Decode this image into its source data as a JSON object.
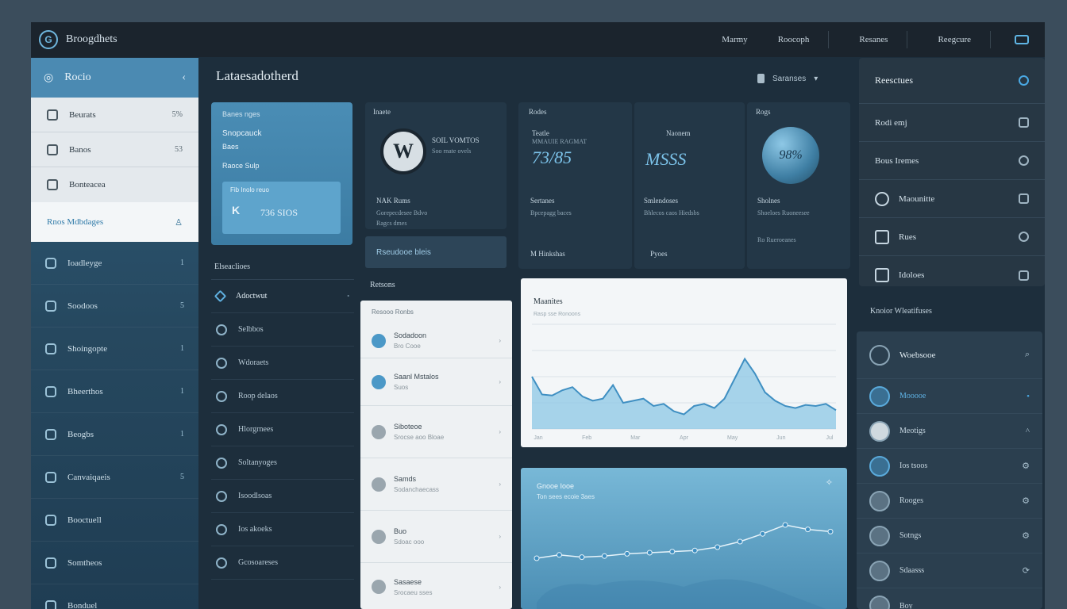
{
  "topbar": {
    "brand": "Broogdhets",
    "nav": [
      "Marmy",
      "Roocoph",
      "Resanes",
      "Reegcure"
    ]
  },
  "sidebar": {
    "header": "Rocio",
    "light_items": [
      {
        "label": "Beurats",
        "trailing": "5%"
      },
      {
        "label": "Banos",
        "trailing": "53"
      },
      {
        "label": "Bonteacea",
        "trailing": ""
      }
    ],
    "active_item": "Rnos Mdbdages",
    "dark_items": [
      {
        "label": "Ioadleyge",
        "trailing": "1"
      },
      {
        "label": "Soodoos",
        "trailing": "5"
      },
      {
        "label": "Shoingopte",
        "trailing": "1"
      },
      {
        "label": "Bheerthos",
        "trailing": "1"
      },
      {
        "label": "Beogbs",
        "trailing": "1"
      },
      {
        "label": "Canvaiqaeis",
        "trailing": "5"
      },
      {
        "label": "Booctuell",
        "trailing": ""
      },
      {
        "label": "Somtheos",
        "trailing": ""
      },
      {
        "label": "Bonduel",
        "trailing": ""
      }
    ]
  },
  "main": {
    "title": "Lataesadotherd",
    "tools": "Saranses",
    "promo": {
      "l1": "Banes nges",
      "l2": "Snopcauck",
      "l3": "Baes",
      "l4": "Raoce Sulp",
      "inner_title": "Fib Inolo reuo",
      "inner_k": "K",
      "inner_value": "736 SIOS"
    },
    "panels": [
      {
        "label": "Inaete",
        "head": "SOIL VOMTOS",
        "sub": "Soo rnate ovels",
        "f1": "NAK Rums",
        "f2": "Gorepecdesee Bdvo",
        "f3": "Ragcs dmes"
      },
      {
        "label": "Rodes",
        "head": "Teatle",
        "sub": "MMAUIE RAGMAT",
        "big": "73/85",
        "f1": "Sertanes",
        "f2": "Bpcepagg baces",
        "bottom": "M Hinkshas"
      },
      {
        "label": "",
        "head": "Naonem",
        "big": "MSSS",
        "f1": "Smlendoses",
        "f2": "Bhlecos caos Hiedsbs",
        "bottom": "Pyoes"
      },
      {
        "label": "Rogs",
        "orb": "98%",
        "f1": "Sholnes",
        "f2": "Shoeloes Ruoneesee",
        "bottom": "Ro Rueroeanes"
      }
    ],
    "button_bar": "Rseudooe bleis",
    "list": {
      "title": "Elseaclioes",
      "items": [
        {
          "label": "Adoctwut",
          "trailing": "•"
        },
        {
          "label": "Selbbos",
          "trailing": ""
        },
        {
          "label": "Wdoraets",
          "trailing": ""
        },
        {
          "label": "Roop delaos",
          "trailing": ""
        },
        {
          "label": "Hlorgrnees",
          "trailing": ""
        },
        {
          "label": "Soltanyoges",
          "trailing": ""
        },
        {
          "label": "Isoodlsoas",
          "trailing": ""
        },
        {
          "label": "Ios akoeks",
          "trailing": ""
        },
        {
          "label": "Gcosoareses",
          "trailing": ""
        }
      ]
    },
    "reviews_label": "Retsons",
    "feed": {
      "head": "Resooo Ronbs",
      "items": [
        {
          "t1": "Sodadoon",
          "t2": "Bro Cooe"
        },
        {
          "t1": "Saanl Mstalos",
          "t2": "Suos"
        },
        {
          "t1": "Siboteoe",
          "t2": "Srocse aoo Bloae"
        },
        {
          "t1": "Samds",
          "t2": "Sodanchaecass"
        },
        {
          "t1": "Buo",
          "t2": "Sdoac ooo"
        },
        {
          "t1": "Sasaese",
          "t2": "Srocaeu sses"
        }
      ]
    },
    "chart": {
      "title": "Maanites",
      "subtitle": "Rasp sse Ronoons",
      "x_ticks": [
        "Jan",
        "Feb",
        "Mar",
        "Apr",
        "May",
        "Jun",
        "Jul"
      ]
    },
    "area": {
      "title": "Gnooe Iooe",
      "subtitle": "Ton sees ecoie 3aes"
    }
  },
  "right": {
    "top_items": [
      {
        "label": "Reesctues"
      },
      {
        "label": "Rodi emj"
      },
      {
        "label": "Bous Iremes"
      },
      {
        "label": "Maounitte"
      },
      {
        "label": "Rues"
      },
      {
        "label": "Idoloes"
      }
    ],
    "section_title": "Knoior Wleatifuses",
    "bottom_items": [
      {
        "label": "Woebsooe",
        "trailing": "⌕"
      },
      {
        "label": "Mooooe",
        "trailing": "•"
      },
      {
        "label": "Meotigs",
        "trailing": "^"
      },
      {
        "label": "Ios tsoos",
        "trailing": "⚙"
      },
      {
        "label": "Rooges",
        "trailing": "⚙"
      },
      {
        "label": "Sotngs",
        "trailing": "⚙"
      },
      {
        "label": "Sdaasss",
        "trailing": "⟳"
      },
      {
        "label": "Boy",
        "trailing": ""
      }
    ]
  },
  "chart_data": [
    {
      "type": "area",
      "title": "Maanites",
      "x": [
        0,
        1,
        2,
        3,
        4,
        5,
        6,
        7,
        8,
        9,
        10,
        11,
        12,
        13,
        14,
        15,
        16,
        17,
        18,
        19,
        20,
        21,
        22,
        23,
        24,
        25,
        26,
        27,
        28,
        29,
        30
      ],
      "series": [
        {
          "values": [
            50,
            33,
            32,
            37,
            40,
            31,
            27,
            29,
            42,
            25,
            27,
            29,
            22,
            24,
            17,
            14,
            22,
            24,
            20,
            29,
            48,
            67,
            53,
            35,
            27,
            22,
            20,
            23,
            22,
            24,
            18
          ]
        }
      ],
      "ylim": [
        0,
        100
      ]
    },
    {
      "type": "line",
      "title": "Gnooe Iooe",
      "x": [
        0,
        1,
        2,
        3,
        4,
        5,
        6,
        7,
        8,
        9,
        10,
        11,
        12,
        13
      ],
      "series": [
        {
          "values": [
            40,
            43,
            41,
            42,
            44,
            45,
            46,
            47,
            50,
            55,
            62,
            70,
            66,
            64
          ]
        }
      ],
      "ylim": [
        0,
        100
      ]
    }
  ]
}
